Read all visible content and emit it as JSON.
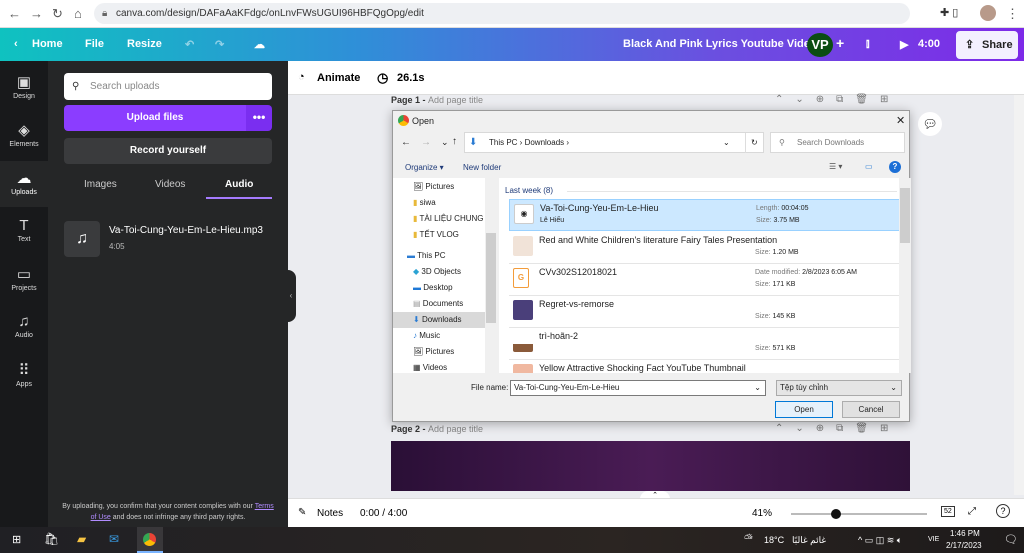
{
  "browser": {
    "url": "canva.com/design/DAFaAaKFdgc/onLnvFWsUGUI96HBFQgOpg/edit"
  },
  "header": {
    "home": "Home",
    "file": "File",
    "resize": "Resize",
    "title": "Black And Pink Lyrics Youtube Video",
    "avatar": "VP",
    "plus": "+",
    "play_time": "4:00",
    "share": "Share",
    "accent": "#7d2ae8"
  },
  "rail": [
    {
      "label": "Design",
      "icon": "▣"
    },
    {
      "label": "Elements",
      "icon": "◈"
    },
    {
      "label": "Uploads",
      "icon": "☁"
    },
    {
      "label": "Text",
      "icon": "T"
    },
    {
      "label": "Projects",
      "icon": "▭"
    },
    {
      "label": "Audio",
      "icon": "♫"
    },
    {
      "label": "Apps",
      "icon": "⠿"
    }
  ],
  "panel": {
    "search_placeholder": "Search uploads",
    "upload": "Upload files",
    "more": "•••",
    "record": "Record yourself",
    "tabs": [
      "Images",
      "Videos",
      "Audio"
    ],
    "active_tab": "Audio",
    "file": {
      "name": "Va-Toi-Cung-Yeu-Em-Le-Hieu.mp3",
      "duration": "4:05"
    },
    "legal_pre": "By uploading, you confirm that your content complies with our ",
    "legal_link": "Terms of Use",
    "legal_post": " and does not infringe any third party rights."
  },
  "toolbar": {
    "animate": "Animate",
    "duration": "26.1s"
  },
  "pages": [
    {
      "label": "Page 1 - ",
      "placeholder": "Add page title"
    },
    {
      "label": "Page 2 - ",
      "placeholder": "Add page title"
    }
  ],
  "dialog": {
    "title": "Open",
    "path": [
      "This PC",
      "Downloads"
    ],
    "search_placeholder": "Search Downloads",
    "organize": "Organize ▾",
    "new_folder": "New folder",
    "tree": [
      "Pictures",
      "siwa",
      "TÀI LIỆU CHUNG",
      "TẾT VLOG",
      "This PC",
      "3D Objects",
      "Desktop",
      "Documents",
      "Downloads",
      "Music",
      "Pictures",
      "Videos"
    ],
    "group": "Last week (8)",
    "files": [
      {
        "name": "Va-Toi-Cung-Yeu-Em-Le-Hieu",
        "author": "Lê Hiếu",
        "meta1_key": "Length:",
        "meta1_val": "00:04:05",
        "size": "3.75 MB"
      },
      {
        "name": "Red and White Children's literature Fairy Tales Presentation",
        "author": "",
        "meta1_key": "",
        "meta1_val": "",
        "size": "1.20 MB"
      },
      {
        "name": "CVv302S12018021",
        "author": "",
        "meta1_key": "Date modified:",
        "meta1_val": "2/8/2023 6:05 AM",
        "size": "171 KB"
      },
      {
        "name": "Regret-vs-remorse",
        "author": "",
        "meta1_key": "",
        "meta1_val": "",
        "size": "145 KB"
      },
      {
        "name": "trì-hoãn-2",
        "author": "",
        "meta1_key": "",
        "meta1_val": "",
        "size": "571 KB"
      },
      {
        "name": "Yellow Attractive Shocking Fact YouTube Thumbnail",
        "author": "",
        "meta1_key": "",
        "meta1_val": "",
        "size": ""
      }
    ],
    "size_key": "Size:",
    "filename_label": "File name:",
    "filename_value": "Va-Toi-Cung-Yeu-Em-Le-Hieu",
    "filetype": "Tệp tùy chỉnh",
    "open": "Open",
    "cancel": "Cancel"
  },
  "bottom": {
    "notes": "Notes",
    "time": "0:00 / 4:00",
    "zoom": "41%",
    "zoom_value": 41,
    "pages_badge": "52"
  },
  "taskbar": {
    "weather": "18°C",
    "weather_text": "غائم غالبًا",
    "lang": "VIE",
    "time": "1:46 PM",
    "date": "2/17/2023"
  }
}
